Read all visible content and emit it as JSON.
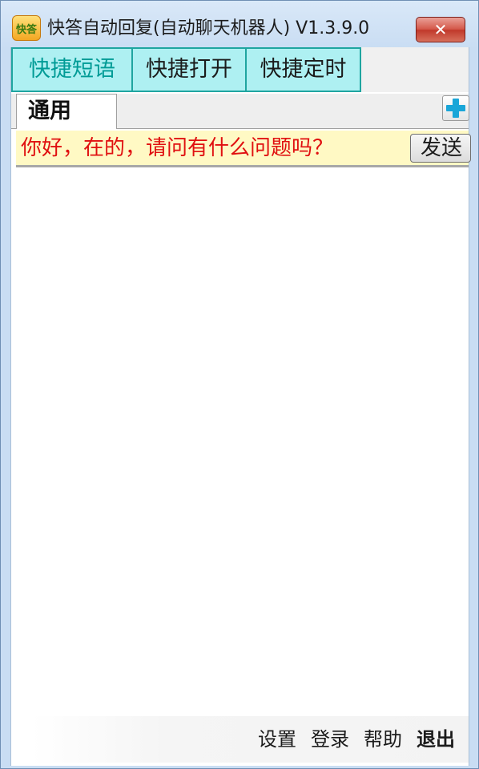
{
  "window": {
    "app_icon_text": "快答",
    "title": "快答自动回复(自动聊天机器人) V1.3.9.0",
    "close_symbol": "✕"
  },
  "main_tabs": [
    {
      "label": "快捷短语",
      "active": true
    },
    {
      "label": "快捷打开",
      "active": false
    },
    {
      "label": "快捷定时",
      "active": false
    }
  ],
  "sub_tabs": [
    {
      "label": "通用",
      "active": true
    }
  ],
  "add_button": {
    "icon": "plus-icon",
    "color": "#1aa6d8"
  },
  "phrases": [
    {
      "text": "你好，在的，请问有什么问题吗？",
      "send_label": "发送"
    }
  ],
  "footer": {
    "settings": "设置",
    "login": "登录",
    "help": "帮助",
    "exit": "退出"
  },
  "colors": {
    "tab_bg": "#aef0f2",
    "tab_border": "#1fa5a0",
    "active_tab_text": "#009b96",
    "phrase_bg": "#fff9c4",
    "phrase_text": "#e01010"
  }
}
